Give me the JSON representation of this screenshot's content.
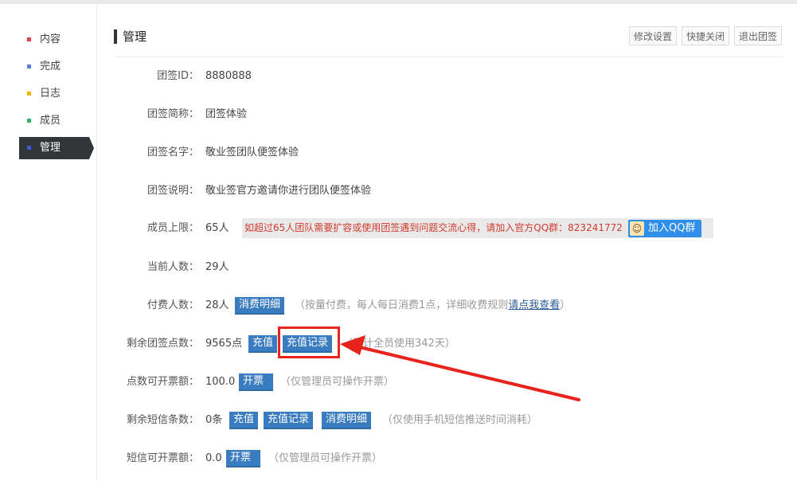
{
  "sidebar": {
    "items": [
      {
        "label": "内容",
        "color": "#e0444a"
      },
      {
        "label": "完成",
        "color": "#5a7fe0"
      },
      {
        "label": "日志",
        "color": "#f4b400"
      },
      {
        "label": "成员",
        "color": "#28b463"
      },
      {
        "label": "管理",
        "color": "#3b5bd9",
        "active": true
      }
    ]
  },
  "header": {
    "title": "管理",
    "buttons": [
      "修改设置",
      "快捷关闭",
      "退出团签"
    ]
  },
  "rows": {
    "team_id": {
      "label": "团签ID：",
      "value": "8880888"
    },
    "short_name": {
      "label": "团签简称：",
      "value": "团签体验"
    },
    "full_name": {
      "label": "团签名字：",
      "value": "敬业签团队便签体验"
    },
    "description": {
      "label": "团签说明：",
      "value": "敬业签官方邀请你进行团队便签体验"
    },
    "member_limit": {
      "label": "成员上限：",
      "value": "65人",
      "banner_text": "如超过65人团队需要扩容或使用团签遇到问题交流心得，请加入官方QQ群：823241772",
      "qq_button": "加入QQ群"
    },
    "current_members": {
      "label": "当前人数：",
      "value": "29人"
    },
    "paid_members": {
      "label": "付费人数：",
      "value": "28人",
      "button": "消费明细",
      "note_prefix": "（按量付费，每人每日消费1点，详细收费规则",
      "note_link": "请点我查看",
      "note_suffix": "）"
    },
    "points_left": {
      "label": "剩余团签点数：",
      "value": "9565点",
      "button_recharge": "充值",
      "button_records": "充值记录",
      "note": "（预计全员使用342天）"
    },
    "invoice_points": {
      "label": "点数可开票额：",
      "value": "100.0",
      "button": "开票",
      "note": "（仅管理员可操作开票）"
    },
    "sms_left": {
      "label": "剩余短信条数：",
      "value": "0条",
      "button_recharge": "充值",
      "button_records": "充值记录",
      "button_details": "消费明细",
      "note": "（仅使用手机短信推送时间消耗）"
    },
    "sms_invoice": {
      "label": "短信可开票额：",
      "value": "0.0",
      "button": "开票",
      "note": "（仅管理员可操作开票）"
    }
  },
  "accent_color": "#3a7cc0",
  "annotation_color": "#e8231c"
}
